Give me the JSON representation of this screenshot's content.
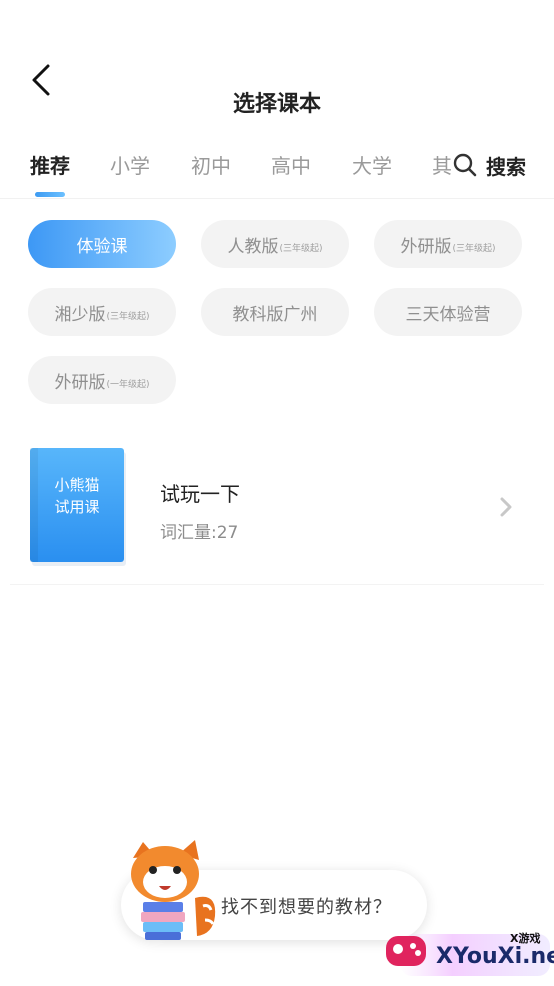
{
  "header": {
    "back_icon": "chevron-left-icon",
    "title": "选择课本"
  },
  "tabs": [
    {
      "label": "推荐",
      "active": true
    },
    {
      "label": "小学",
      "active": false
    },
    {
      "label": "初中",
      "active": false
    },
    {
      "label": "高中",
      "active": false
    },
    {
      "label": "大学",
      "active": false
    },
    {
      "label": "其",
      "active": false
    }
  ],
  "search": {
    "icon": "search-icon",
    "label": "搜索"
  },
  "chips": [
    {
      "label": "体验课",
      "note": "",
      "active": true
    },
    {
      "label": "人教版",
      "note": "(三年级起)",
      "active": false
    },
    {
      "label": "外研版",
      "note": "(三年级起)",
      "active": false
    },
    {
      "label": "湘少版",
      "note": "(三年级起)",
      "active": false
    },
    {
      "label": "教科版广州",
      "note": "",
      "active": false
    },
    {
      "label": "三天体验营",
      "note": "",
      "active": false
    },
    {
      "label": "外研版",
      "note": "(一年级起)",
      "active": false
    }
  ],
  "book": {
    "cover_line1": "小熊猫",
    "cover_line2": "试用课",
    "title": "试玩一下",
    "vocab": "词汇量:27",
    "arrow_icon": "chevron-right-icon"
  },
  "help": {
    "mascot": "red-panda-mascot",
    "text": "找不到想要的教材？"
  },
  "watermark": {
    "text": "XYouXi.net",
    "small": "X游戏",
    "icon": "gamepad-icon"
  },
  "colors": {
    "accent": "#3d98f5",
    "accent_light": "#8dcdff",
    "chip_bg": "#f3f3f3",
    "text_primary": "#222222",
    "text_muted": "#9a9a9a"
  }
}
